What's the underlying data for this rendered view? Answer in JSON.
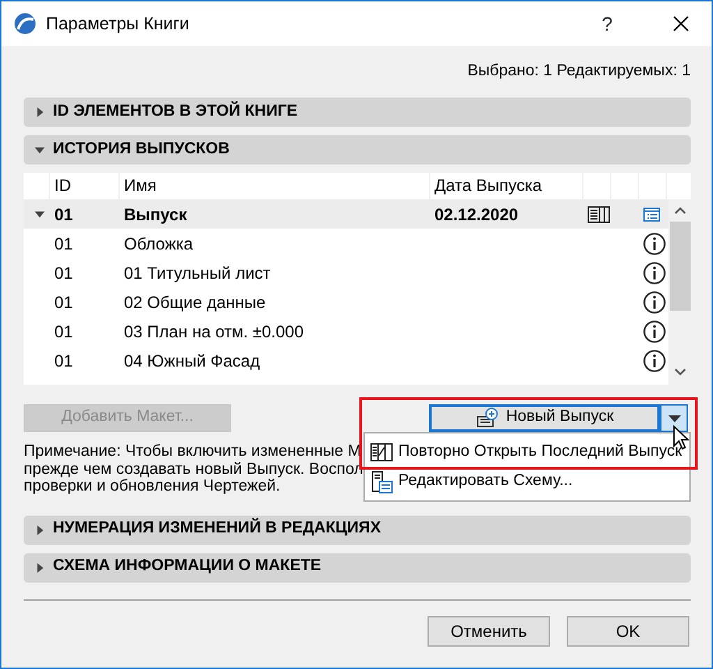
{
  "window": {
    "title": "Параметры Книги",
    "help": "?"
  },
  "selection_info": "Выбрано: 1 Редактируемых: 1",
  "sections_top": [
    {
      "title": "ID ЭЛЕМЕНТОВ В ЭТОЙ КНИГЕ",
      "expanded": false
    },
    {
      "title": "ИСТОРИЯ ВЫПУСКОВ",
      "expanded": true
    }
  ],
  "table": {
    "columns": [
      "ID",
      "Имя",
      "Дата Выпуска"
    ],
    "rows": [
      {
        "kind": "group",
        "expanded": true,
        "id": "01",
        "name": "Выпуск",
        "date": "02.12.2020"
      },
      {
        "kind": "item",
        "id": "01",
        "name": "Обложка"
      },
      {
        "kind": "item",
        "id": "01",
        "name": "01 Титульный лист"
      },
      {
        "kind": "item",
        "id": "01",
        "name": "02 Общие данные"
      },
      {
        "kind": "item",
        "id": "01",
        "name": "03 План на отм. ±0.000"
      },
      {
        "kind": "item",
        "id": "01",
        "name": "04 Южный Фасад"
      }
    ]
  },
  "add_layout_button": {
    "label": "Добавить Макет...",
    "disabled": true
  },
  "new_issue_button": {
    "label": "Новый Выпуск"
  },
  "menu": {
    "items": [
      {
        "label": "Повторно Открыть Последний Выпуск",
        "kind": "reopen"
      },
      {
        "label": "Редактировать Схему...",
        "kind": "edit"
      }
    ]
  },
  "note_lines": [
    "Примечание: Чтобы включить измененные М",
    "прежде чем создавать новый Выпуск. Воспол",
    "проверки и обновления Чертежей."
  ],
  "sections_bottom": [
    {
      "title": "НУМЕРАЦИЯ ИЗМЕНЕНИЙ В РЕДАКЦИЯХ",
      "expanded": false
    },
    {
      "title": "СХЕМА ИНФОРМАЦИИ О МАКЕТЕ",
      "expanded": false
    }
  ],
  "footer_buttons": [
    "Отменить",
    "OK"
  ]
}
